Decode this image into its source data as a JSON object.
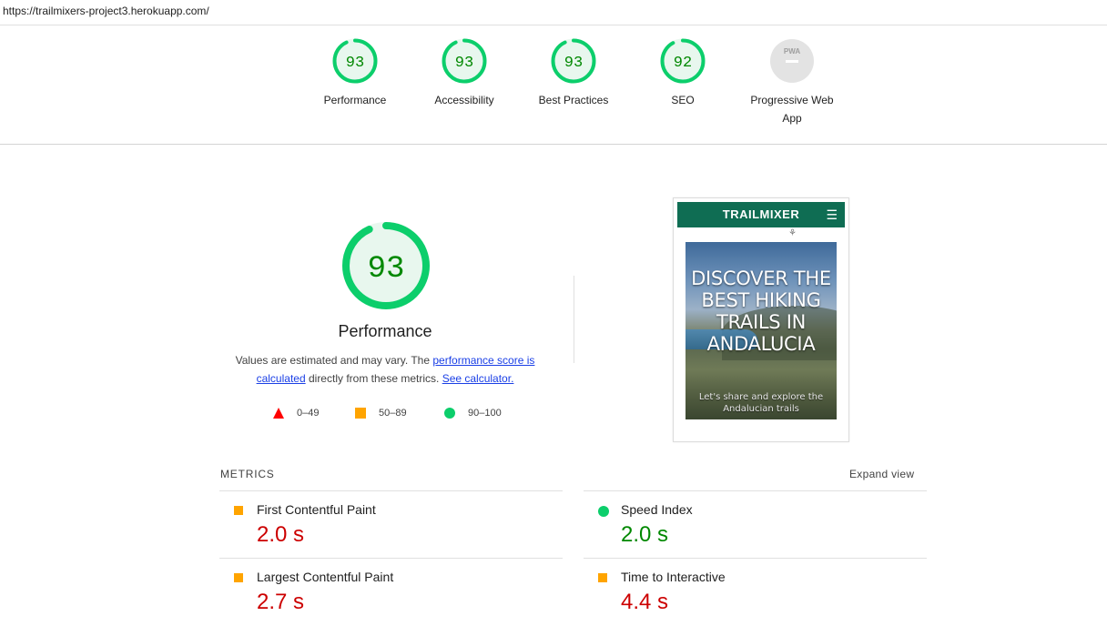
{
  "url": "https://trailmixers-project3.herokuapp.com/",
  "colors": {
    "pass": "#0cce6b",
    "pass_text": "#008800",
    "average": "#ffa400",
    "fail": "#ff3333",
    "fail_text": "#cc0000",
    "na": "#cccccc",
    "link": "#1a3fe6"
  },
  "categories": [
    {
      "label": "Performance",
      "score": "93",
      "value": 93
    },
    {
      "label": "Accessibility",
      "score": "93",
      "value": 93
    },
    {
      "label": "Best Practices",
      "score": "93",
      "value": 93
    },
    {
      "label": "SEO",
      "score": "92",
      "value": 92
    },
    {
      "label": "Progressive Web App",
      "badge": "PWA",
      "icon": "pwa-dash-icon"
    }
  ],
  "performance": {
    "score": "93",
    "value": 93,
    "title": "Performance",
    "desc_prefix": "Values are estimated and may vary. The ",
    "desc_link1": "performance score is calculated",
    "desc_mid": " directly from these metrics. ",
    "desc_link2": "See calculator."
  },
  "legend": [
    {
      "range": "0–49",
      "icon": "red-triangle-icon"
    },
    {
      "range": "50–89",
      "icon": "orange-square-icon"
    },
    {
      "range": "90–100",
      "icon": "green-circle-icon"
    }
  ],
  "screenshot": {
    "brand": "TRAILMIXER",
    "menu_glyph": "☰",
    "hiker_glyph": "⚘",
    "headline": "DISCOVER THE BEST HIKING TRAILS IN ANDALUCIA",
    "subtext": "Let's share and explore the Andalucian trails"
  },
  "metrics": {
    "header": "METRICS",
    "expand": "Expand view",
    "items": [
      {
        "name": "First Contentful Paint",
        "value": "2.0 s",
        "status": "average",
        "icon": "orange-square-icon"
      },
      {
        "name": "Speed Index",
        "value": "2.0 s",
        "status": "pass",
        "icon": "green-circle-icon"
      },
      {
        "name": "Largest Contentful Paint",
        "value": "2.7 s",
        "status": "average",
        "icon": "orange-square-icon"
      },
      {
        "name": "Time to Interactive",
        "value": "4.4 s",
        "status": "average",
        "icon": "orange-square-icon"
      }
    ]
  }
}
